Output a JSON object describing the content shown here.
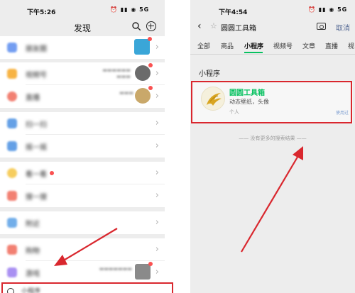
{
  "left_phone": {
    "status_time": "下午5:26",
    "status_icons": "⏰ ▮▮ ◉ 5G",
    "title": "发现",
    "rows": [
      {
        "label": "朋友圈",
        "icon_color": "#5b8def"
      },
      {
        "label": "视频号",
        "icon_color": "#f6a623"
      },
      {
        "label": "直播",
        "icon_color": "#f06a5a"
      },
      {
        "label": "扫一扫",
        "icon_color": "#4a90e2"
      },
      {
        "label": "摇一摇",
        "icon_color": "#4a90e2"
      },
      {
        "label": "看一看",
        "icon_color": "#f5c542"
      },
      {
        "label": "搜一搜",
        "icon_color": "#f06a5a"
      },
      {
        "label": "附近",
        "icon_color": "#5aa0e6"
      },
      {
        "label": "购物",
        "icon_color": "#f06a5a"
      },
      {
        "label": "游戏",
        "icon_color": "#9b7df0"
      }
    ],
    "bottom_row_label": "小程序"
  },
  "right_phone": {
    "status_time": "下午4:54",
    "status_icons": "⏰ ▮▮ ◉ 5G",
    "query": "圆圆工具箱",
    "cancel_label": "取消",
    "tabs": [
      "全部",
      "商品",
      "小程序",
      "视频号",
      "文章",
      "直播",
      "视"
    ],
    "active_tab": "小程序",
    "section_title": "小程序",
    "result": {
      "name": "圆圆工具箱",
      "description": "动态壁纸，头像",
      "subtitle": "个人",
      "badge": "使用过"
    },
    "no_more_text": "—— 没有更多的搜索结果 ——"
  },
  "colors": {
    "accent_green": "#07c160",
    "highlight_red": "#d9272e",
    "link_blue": "#576b95"
  }
}
